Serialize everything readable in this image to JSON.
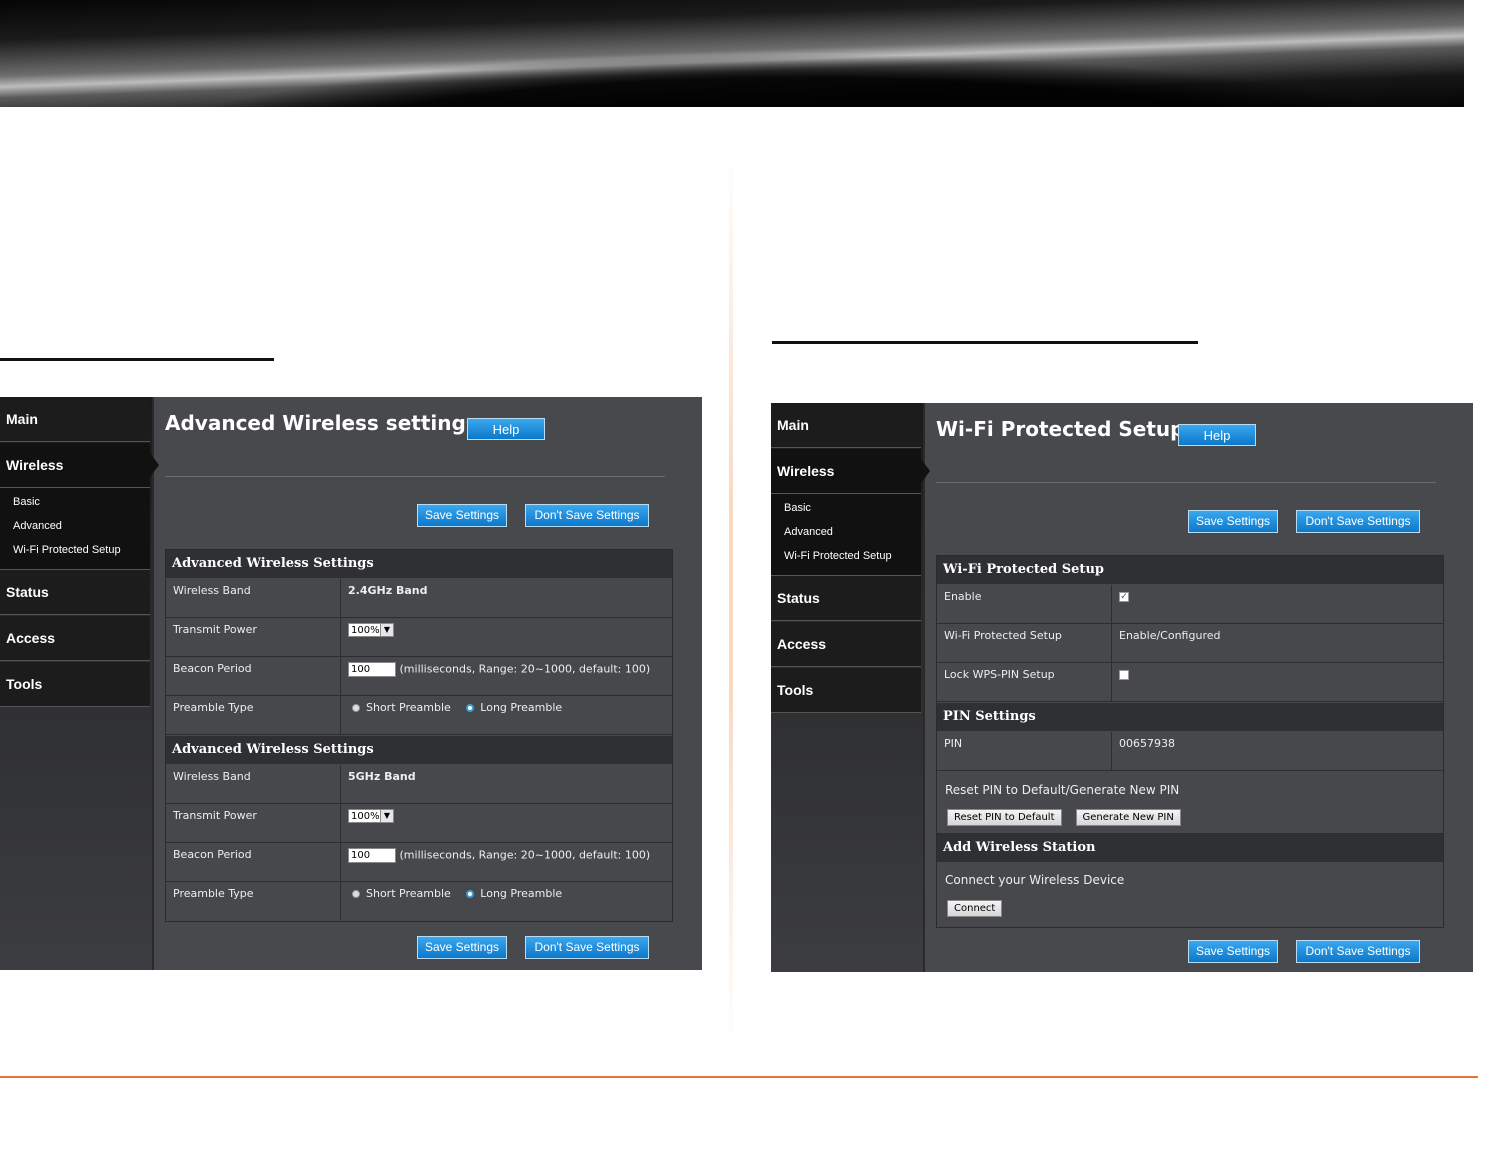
{
  "left": {
    "nav": {
      "main": "Main",
      "wireless": "Wireless",
      "sub": [
        "Basic",
        "Advanced",
        "Wi-Fi Protected Setup"
      ],
      "status": "Status",
      "access": "Access",
      "tools": "Tools"
    },
    "title": "Advanced Wireless settings",
    "help": "Help",
    "save": "Save Settings",
    "dont_save": "Don't Save Settings",
    "sections": [
      {
        "header": "Advanced Wireless Settings",
        "band_label": "Wireless Band",
        "band_value": "2.4GHz Band",
        "power_label": "Transmit Power",
        "power_value": "100%",
        "beacon_label": "Beacon Period",
        "beacon_value": "100",
        "beacon_hint": "(milliseconds, Range: 20~1000, default: 100)",
        "preamble_label": "Preamble Type",
        "short": "Short Preamble",
        "long": "Long Preamble"
      },
      {
        "header": "Advanced Wireless Settings",
        "band_label": "Wireless Band",
        "band_value": "5GHz Band",
        "power_label": "Transmit Power",
        "power_value": "100%",
        "beacon_label": "Beacon Period",
        "beacon_value": "100",
        "beacon_hint": "(milliseconds, Range: 20~1000, default: 100)",
        "preamble_label": "Preamble Type",
        "short": "Short Preamble",
        "long": "Long Preamble"
      }
    ]
  },
  "right": {
    "nav": {
      "main": "Main",
      "wireless": "Wireless",
      "sub": [
        "Basic",
        "Advanced",
        "Wi-Fi Protected Setup"
      ],
      "status": "Status",
      "access": "Access",
      "tools": "Tools"
    },
    "title": "Wi-Fi Protected Setup",
    "help": "Help",
    "save": "Save Settings",
    "dont_save": "Don't Save Settings",
    "wps": {
      "header": "Wi-Fi Protected Setup",
      "enable_label": "Enable",
      "status_label": "Wi-Fi Protected Setup",
      "status_value": "Enable/Configured",
      "lock_label": "Lock WPS-PIN Setup"
    },
    "pin": {
      "header": "PIN Settings",
      "pin_label": "PIN",
      "pin_value": "00657938",
      "reset_text": "Reset PIN to Default/Generate New PIN",
      "reset_btn": "Reset PIN to Default",
      "generate_btn": "Generate New PIN"
    },
    "station": {
      "header": "Add Wireless Station",
      "text": "Connect your Wireless Device",
      "connect_btn": "Connect"
    }
  }
}
